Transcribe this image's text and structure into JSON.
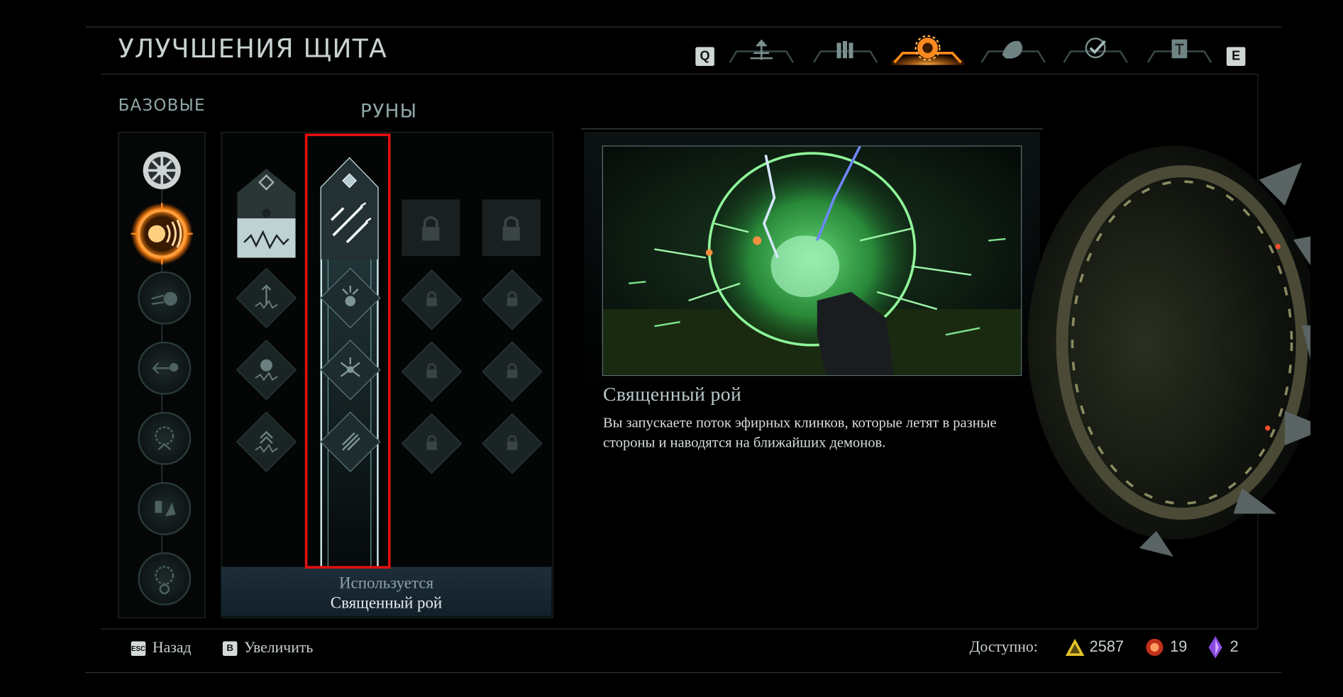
{
  "header": {
    "title": "УЛУЧШЕНИЯ ЩИТА",
    "key_left": "Q",
    "key_right": "E",
    "tabs": [
      {
        "icon": "map-icon",
        "active": false
      },
      {
        "icon": "ammo-icon",
        "active": false
      },
      {
        "icon": "shield-saw-icon",
        "active": true
      },
      {
        "icon": "armor-fist-icon",
        "active": false
      },
      {
        "icon": "checkmark-icon",
        "active": false
      },
      {
        "icon": "codex-icon",
        "active": false
      }
    ]
  },
  "basic": {
    "label": "БАЗОВЫЕ",
    "nodes": [
      {
        "icon": "saw-blade-icon",
        "state": "unlocked"
      },
      {
        "icon": "shield-charge-icon",
        "state": "selected"
      },
      {
        "icon": "shield-dash-icon",
        "state": "inactive"
      },
      {
        "icon": "pull-demon-icon",
        "state": "inactive"
      },
      {
        "icon": "blade-burst-icon",
        "state": "inactive"
      },
      {
        "icon": "energy-demon-icon",
        "state": "inactive"
      },
      {
        "icon": "saw-timer-icon",
        "state": "inactive"
      }
    ]
  },
  "runes": {
    "label": "РУНЫ",
    "columns": [
      {
        "head_icon": "shock-demon-icon",
        "state": "unlocked",
        "upgrades": [
          "upgrade-up-icon",
          "demon-burst-icon",
          "chevrons-up-icon"
        ]
      },
      {
        "head_icon": "holy-swarm-icon",
        "state": "equipped",
        "upgrades": [
          "blades-demon-icon",
          "blades-spread-icon",
          "blades-fan-icon"
        ]
      },
      {
        "head_icon": "lock-icon",
        "state": "locked",
        "upgrades": [
          "lock-icon",
          "lock-icon",
          "lock-icon"
        ]
      },
      {
        "head_icon": "lock-icon",
        "state": "locked",
        "upgrades": [
          "lock-icon",
          "lock-icon",
          "lock-icon"
        ]
      }
    ],
    "status_label": "Используется",
    "status_value": "Священный рой"
  },
  "detail": {
    "title": "Священный рой",
    "description": "Вы запускаете поток эфирных клинков, которые летят в разные стороны и наводятся на ближайших демонов."
  },
  "footer": {
    "back_key": "ESC",
    "back_label": "Назад",
    "zoom_key": "B",
    "zoom_label": "Увеличить",
    "available_label": "Доступно:",
    "currency_1": "2587",
    "currency_2": "19",
    "currency_3": "2"
  },
  "colors": {
    "accent": "#f08a20",
    "highlight_red": "#e01010",
    "rune_glow": "#cfe9ea",
    "green_glow": "#3cd45a"
  }
}
